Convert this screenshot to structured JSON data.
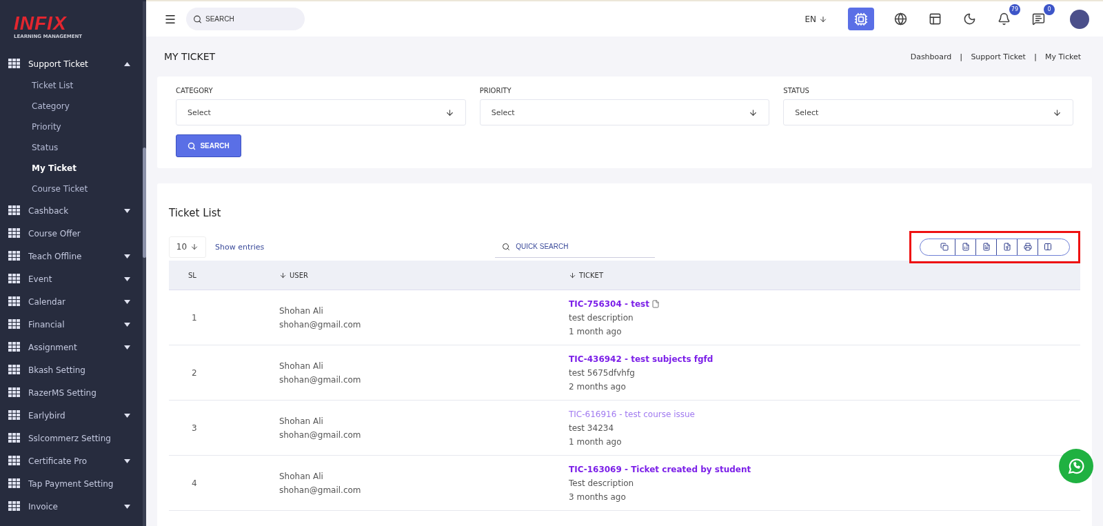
{
  "brand": {
    "logo": "INFIX",
    "tagline": "LEARNING MANAGEMENT"
  },
  "sidebar": {
    "items": [
      {
        "label": "Support Ticket",
        "kind": "group",
        "expanded": true,
        "selected": true,
        "children": [
          {
            "label": "Ticket List",
            "selected": false
          },
          {
            "label": "Category",
            "selected": false
          },
          {
            "label": "Priority",
            "selected": false
          },
          {
            "label": "Status",
            "selected": false
          },
          {
            "label": "My Ticket",
            "selected": true
          },
          {
            "label": "Course Ticket",
            "selected": false
          }
        ]
      },
      {
        "label": "Cashback",
        "kind": "group",
        "expanded": false,
        "selected": false
      },
      {
        "label": "Course Offer",
        "kind": "link",
        "selected": false
      },
      {
        "label": "Teach Offline",
        "kind": "group",
        "expanded": false,
        "selected": false
      },
      {
        "label": "Event",
        "kind": "group",
        "expanded": false,
        "selected": false
      },
      {
        "label": "Calendar",
        "kind": "group",
        "expanded": false,
        "selected": false
      },
      {
        "label": "Financial",
        "kind": "group",
        "expanded": false,
        "selected": false
      },
      {
        "label": "Assignment",
        "kind": "group",
        "expanded": false,
        "selected": false
      },
      {
        "label": "Bkash Setting",
        "kind": "link",
        "selected": false
      },
      {
        "label": "RazerMS Setting",
        "kind": "link",
        "selected": false
      },
      {
        "label": "Earlybird",
        "kind": "group",
        "expanded": false,
        "selected": false
      },
      {
        "label": "Sslcommerz Setting",
        "kind": "link",
        "selected": false
      },
      {
        "label": "Certificate Pro",
        "kind": "group",
        "expanded": false,
        "selected": false
      },
      {
        "label": "Tap Payment Setting",
        "kind": "link",
        "selected": false
      },
      {
        "label": "Invoice",
        "kind": "group",
        "expanded": false,
        "selected": false
      }
    ]
  },
  "topbar": {
    "search": {
      "placeholder": "SEARCH"
    },
    "language": "EN",
    "notifications": "79",
    "messages": "0"
  },
  "page": {
    "title": "MY TICKET",
    "breadcrumbs": [
      {
        "kind": "link",
        "text": "Dashboard"
      },
      {
        "kind": "separator",
        "text": "|"
      },
      {
        "kind": "link",
        "text": "Support Ticket"
      },
      {
        "kind": "separator",
        "text": "|"
      },
      {
        "kind": "link",
        "text": "My Ticket"
      }
    ]
  },
  "filters": {
    "fields": [
      {
        "label": "CATEGORY",
        "placeholder": "Select"
      },
      {
        "label": "PRIORITY",
        "placeholder": "Select"
      },
      {
        "label": "STATUS",
        "placeholder": "Select"
      }
    ],
    "button": "SEARCH"
  },
  "ticket_list": {
    "title": "Ticket List",
    "page_size": "10",
    "show_entries": "Show entries",
    "quick_search": {
      "placeholder": "QUICK SEARCH"
    },
    "export_highlighted": true,
    "columns": [
      "SL",
      "USER",
      "TICKET"
    ],
    "rows": [
      {
        "sl": "1",
        "name": "Shohan Ali",
        "email": "shohan@gmail.com",
        "ticket": "TIC-756304 - test",
        "attachment": true,
        "seen": false,
        "description": "test description",
        "time": "1 month ago"
      },
      {
        "sl": "2",
        "name": "Shohan Ali",
        "email": "shohan@gmail.com",
        "ticket": "TIC-436942 - test subjects fgfd",
        "attachment": false,
        "seen": false,
        "description": "test 5675dfvhfg",
        "time": "2 months ago"
      },
      {
        "sl": "3",
        "name": "Shohan Ali",
        "email": "shohan@gmail.com",
        "ticket": "TIC-616916 - test course issue",
        "attachment": false,
        "seen": true,
        "description": "test 34234",
        "time": "1 month ago"
      },
      {
        "sl": "4",
        "name": "Shohan Ali",
        "email": "shohan@gmail.com",
        "ticket": "TIC-163069 - Ticket created by student",
        "attachment": false,
        "seen": false,
        "description": "Test description",
        "time": "3 months ago"
      }
    ]
  }
}
